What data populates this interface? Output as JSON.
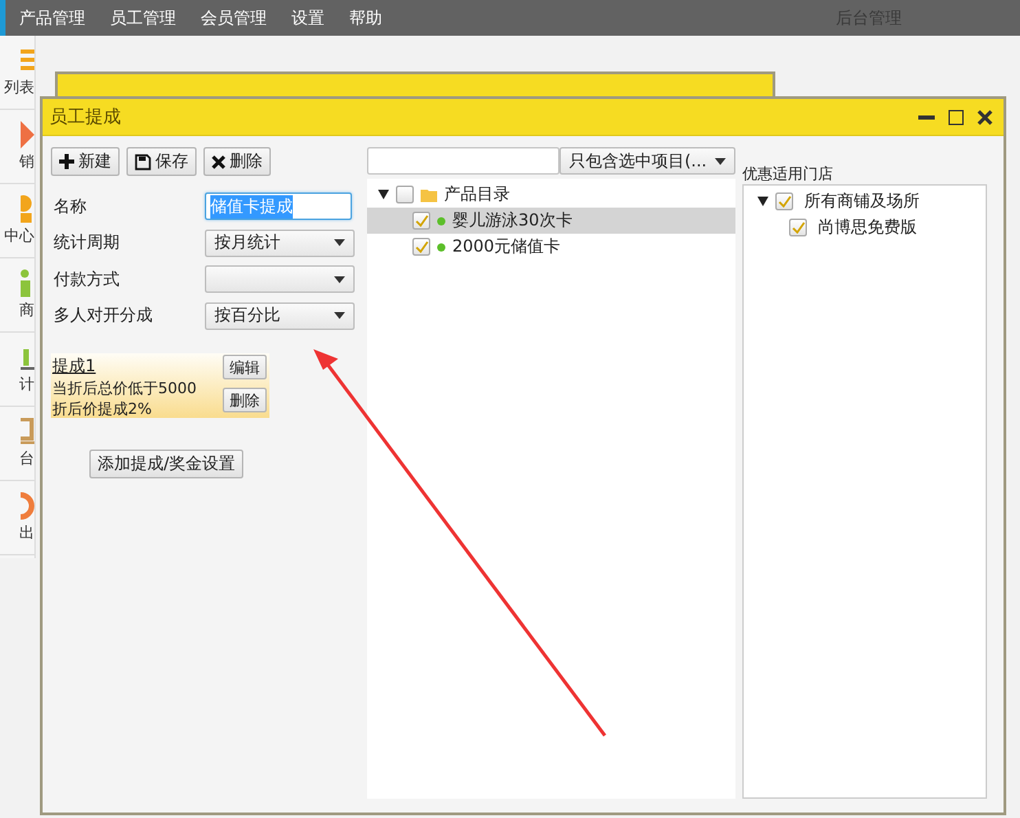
{
  "menu": {
    "items": [
      "产品管理",
      "员工管理",
      "会员管理",
      "设置",
      "帮助"
    ],
    "title": "后台管理"
  },
  "sidebar": {
    "items": [
      "列表",
      "销",
      "中心",
      "商",
      "计",
      "台",
      "出"
    ]
  },
  "window": {
    "title": "员工提成",
    "toolbar": [
      {
        "kind": "add",
        "label": "新建"
      },
      {
        "kind": "save",
        "label": "保存"
      },
      {
        "kind": "delete",
        "label": "删除"
      }
    ],
    "form": [
      {
        "label": "名称",
        "kind": "text",
        "value": "储值卡提成",
        "highlighted": true
      },
      {
        "label": "统计周期",
        "kind": "select",
        "value": "按月统计"
      },
      {
        "label": "付款方式",
        "kind": "select"
      },
      {
        "label": "多人对开分成",
        "kind": "select",
        "value": "按百分比"
      }
    ],
    "rules": [
      {
        "title": "提成1",
        "lines": [
          "当折后总价低于5000",
          "折后价提成2%"
        ],
        "buttons": [
          "编辑",
          "删除"
        ]
      }
    ],
    "add_button": "添加提成/奖金设置",
    "filter": {
      "value": "只包含选中项目(..."
    },
    "product_tree": {
      "label": "产品目录",
      "checked": false,
      "expanded": true,
      "children": [
        {
          "label": "婴儿游泳30次卡",
          "checked": true,
          "selected": true
        },
        {
          "label": "2000元储值卡",
          "checked": true,
          "selected": false
        }
      ]
    },
    "store_label": "优惠适用门店",
    "store_tree": {
      "label": "所有商铺及场所",
      "checked": true,
      "expanded": true,
      "children": [
        {
          "label": "尚博思免费版",
          "checked": true
        }
      ]
    }
  }
}
